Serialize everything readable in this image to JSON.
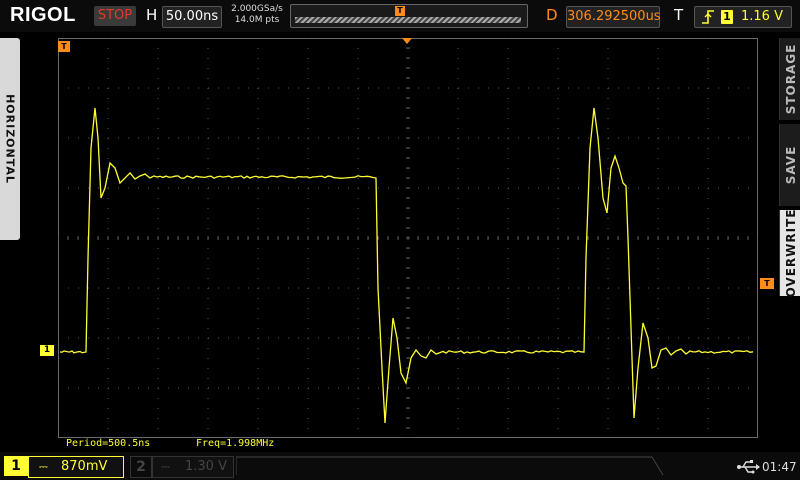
{
  "header": {
    "brand": "RIGOL",
    "run_state": "STOP",
    "horizontal_letter": "H",
    "timebase": "50.00ns",
    "sample_rate": "2.000GSa/s",
    "memory_depth": "14.0M pts",
    "trigger_marker": "T",
    "delay_letter": "D",
    "delay_value": "306.292500us",
    "trigger_letter": "T",
    "trigger_edge_icon": "rising-edge-icon",
    "trigger_source": "1",
    "trigger_level": "1.16 V"
  },
  "left_tab": {
    "label": "HORIZONTAL"
  },
  "right_menu": {
    "items": [
      {
        "label": "STORAGE"
      },
      {
        "label": "SAVE"
      },
      {
        "label": "OVERWRITE",
        "selected": true
      }
    ]
  },
  "screen": {
    "marker_trigger_pos": "T",
    "marker_trigger_level": "T",
    "marker_ch1": "1"
  },
  "measurements": {
    "period": "Period=500.5ns",
    "freq": "Freq=1.998MHz"
  },
  "footer": {
    "ch1": {
      "number": "1",
      "coupling": "⎓",
      "scale": "870mV"
    },
    "ch2": {
      "number": "2",
      "coupling": "⎓",
      "scale": "1.30 V"
    },
    "usb_icon": "usb-icon",
    "time": "01:47"
  },
  "colors": {
    "ch1": "#ffff33",
    "accent": "#ff8c1a",
    "stop": "#e23a2a",
    "grid": "#5a5a5a"
  }
}
